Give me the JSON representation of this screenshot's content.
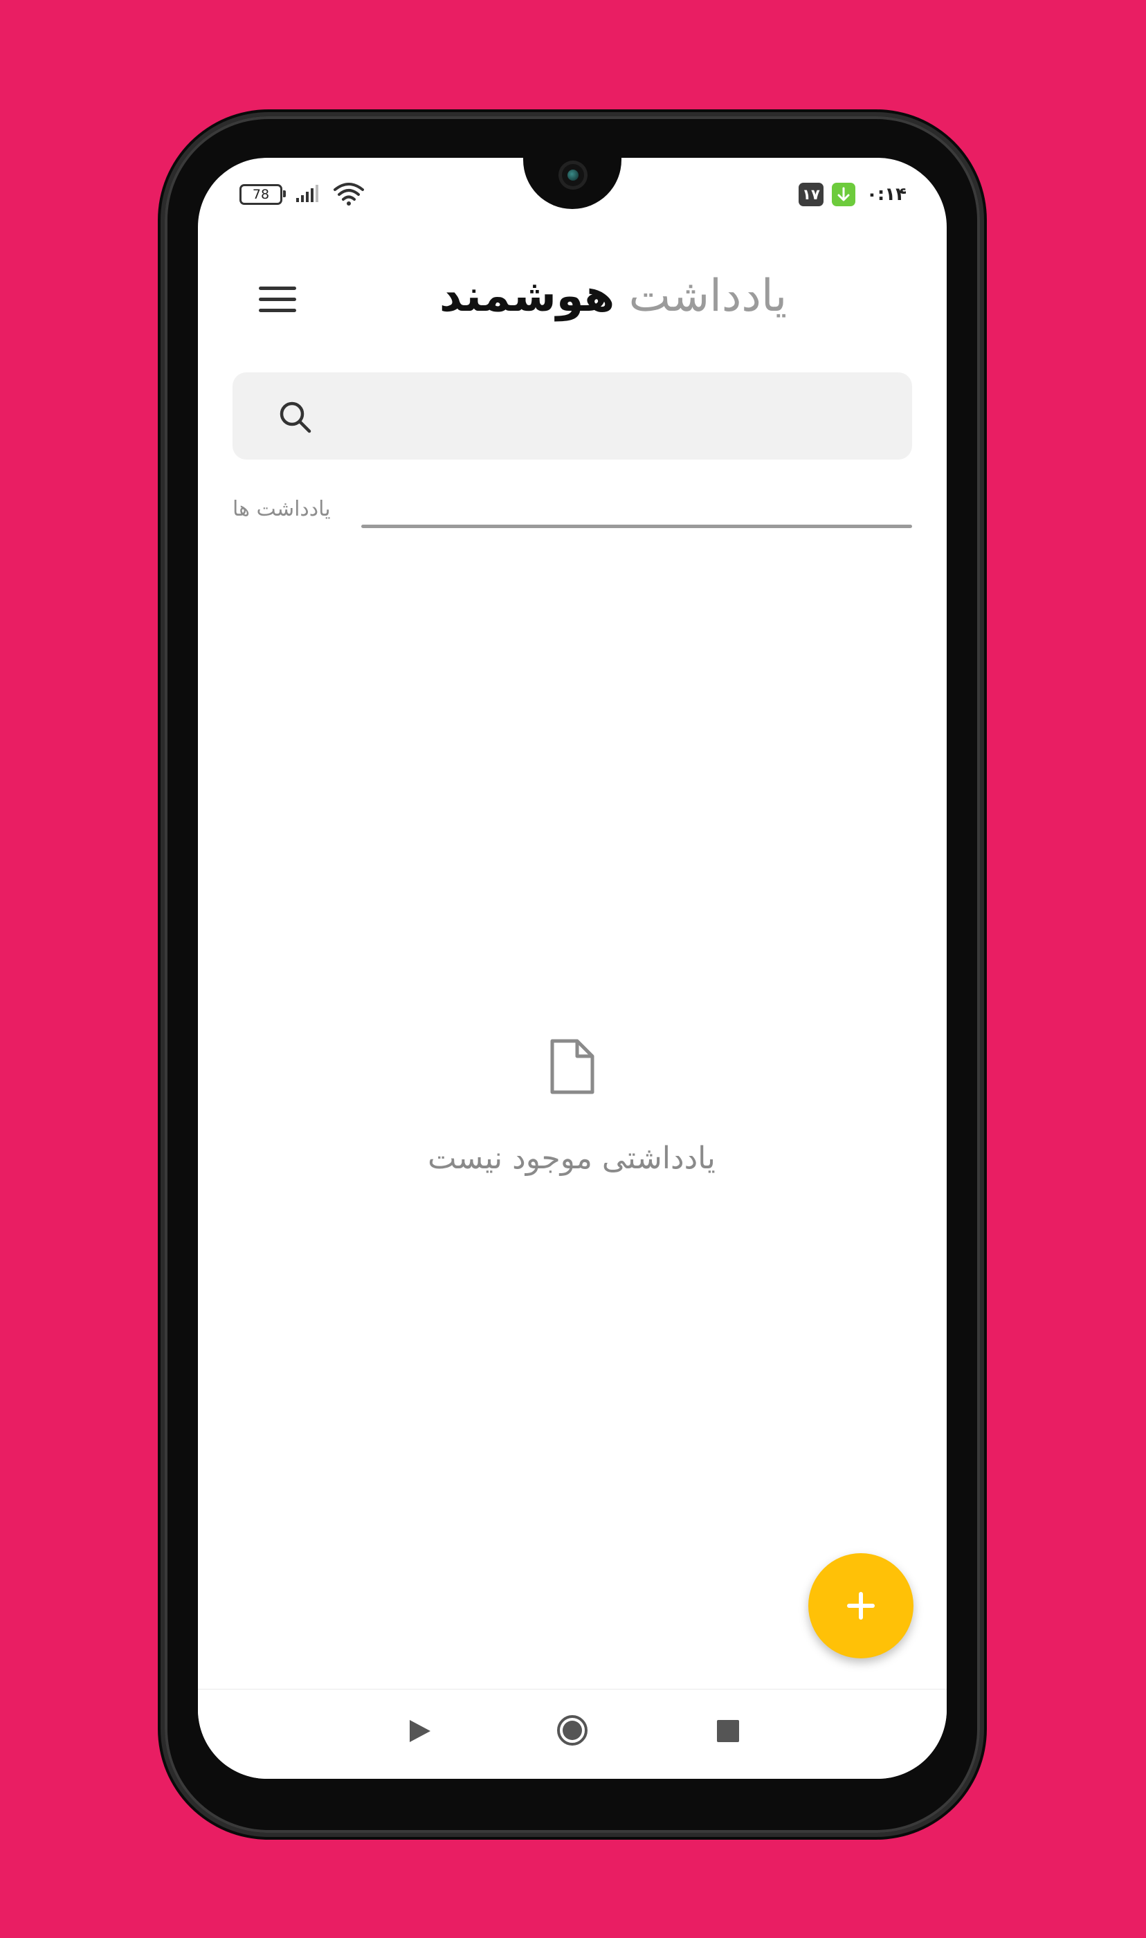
{
  "theme": {
    "background": "#E91E63",
    "fab_color": "#FFC107",
    "search_bg": "#F1F1F1"
  },
  "status_bar": {
    "battery": "78",
    "notification_badge": "۱۷",
    "time": "۰:۱۴",
    "icons": [
      "battery-icon",
      "signal-icon",
      "wifi-icon",
      "download-icon"
    ]
  },
  "header": {
    "title_light": "یادداشت",
    "title_bold": "هوشمند",
    "menu_icon": "hamburger-menu-icon"
  },
  "search": {
    "placeholder": "",
    "value": "",
    "icon": "search-icon"
  },
  "notes_section": {
    "label": "یادداشت ها"
  },
  "empty_state": {
    "icon": "document-icon",
    "message": "یادداشتی موجود نیست"
  },
  "fab": {
    "icon": "plus-icon"
  },
  "nav_bar": {
    "icons": [
      "back-icon",
      "home-icon",
      "recents-icon"
    ]
  }
}
